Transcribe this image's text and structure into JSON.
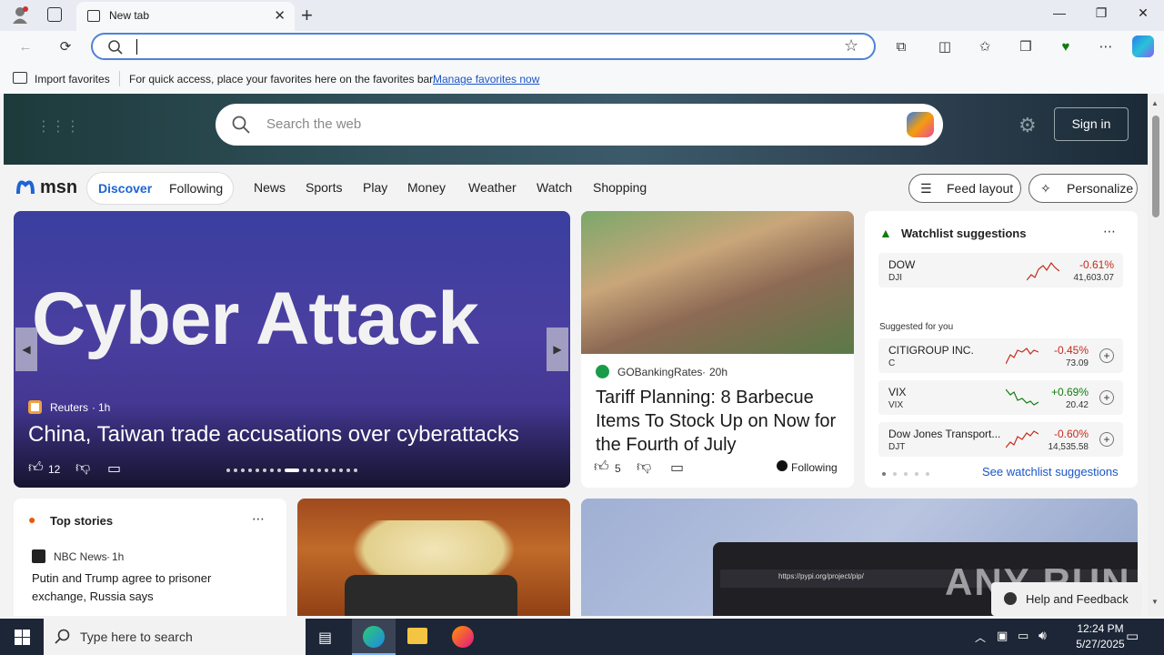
{
  "browser": {
    "tab_title": "New tab",
    "address_value": "",
    "favorites_bar": {
      "import_label": "Import favorites",
      "hint_text": "For quick access, place your favorites here on the favorites bar.",
      "manage_link": "Manage favorites now"
    }
  },
  "msn": {
    "search_placeholder": "Search the web",
    "sign_in": "Sign in",
    "logo": "msn",
    "nav_tabs": [
      "Discover",
      "Following"
    ],
    "nav_links": [
      "News",
      "Sports",
      "Play",
      "Money",
      "Weather",
      "Watch",
      "Shopping"
    ],
    "feed_layout": "Feed layout",
    "personalize": "Personalize"
  },
  "hero_story": {
    "image_text": "Cyber Attack",
    "source": "Reuters",
    "age": "1h",
    "headline": "China, Taiwan trade accusations over cyberattacks",
    "likes": "12"
  },
  "story2": {
    "source": "GOBankingRates",
    "age": "20h",
    "headline": "Tariff Planning: 8 Barbecue Items To Stock Up on Now for the Fourth of July",
    "likes": "5",
    "following": "Following"
  },
  "watchlist": {
    "title": "Watchlist suggestions",
    "suggested_label": "Suggested for you",
    "see_more": "See watchlist suggestions",
    "red": "#c42b1c",
    "green": "#107c10",
    "stocks": [
      {
        "name": "DOW",
        "symbol": "DJI",
        "change": "-0.61%",
        "value": "41,603.07"
      },
      {
        "name": "CITIGROUP INC.",
        "symbol": "C",
        "change": "-0.45%",
        "value": "73.09"
      },
      {
        "name": "VIX",
        "symbol": "VIX",
        "change": "+0.69%",
        "value": "20.42"
      },
      {
        "name": "Dow Jones Transport...",
        "symbol": "DJT",
        "change": "-0.60%",
        "value": "14,535.58"
      }
    ]
  },
  "top_stories": {
    "title": "Top stories",
    "source": "NBC News",
    "age": "1h",
    "headline": "Putin and Trump agree to prisoner exchange, Russia says"
  },
  "laptop_card": {
    "url_text": "https://pypi.org/project/pip/",
    "watermark": "ANY RUN",
    "help_button": "Help and Feedback"
  },
  "taskbar": {
    "search_placeholder": "Type here to search",
    "time": "12:24 PM",
    "date": "5/27/2025"
  }
}
